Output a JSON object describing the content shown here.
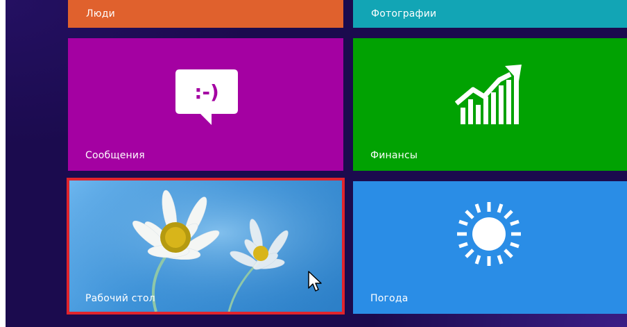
{
  "tiles": {
    "people": {
      "label": "Люди",
      "color": "#e0612d"
    },
    "photos": {
      "label": "Фотографии",
      "color": "#12a5b5"
    },
    "messages": {
      "label": "Сообщения",
      "color": "#a401a2",
      "icon": "chat-emoticon-icon",
      "icon_text": ":-)"
    },
    "finance": {
      "label": "Финансы",
      "color": "#01a202",
      "icon": "finance-chart-icon"
    },
    "desktop": {
      "label": "Рабочий стол",
      "color": "#3e93d9",
      "highlight": "#e0242c",
      "image": "daisy-flowers-image"
    },
    "weather": {
      "label": "Погода",
      "color": "#2a8de6",
      "icon": "sun-icon"
    }
  },
  "pointer": {
    "icon": "mouse-cursor-icon"
  },
  "background_color": "#1b0b4e"
}
